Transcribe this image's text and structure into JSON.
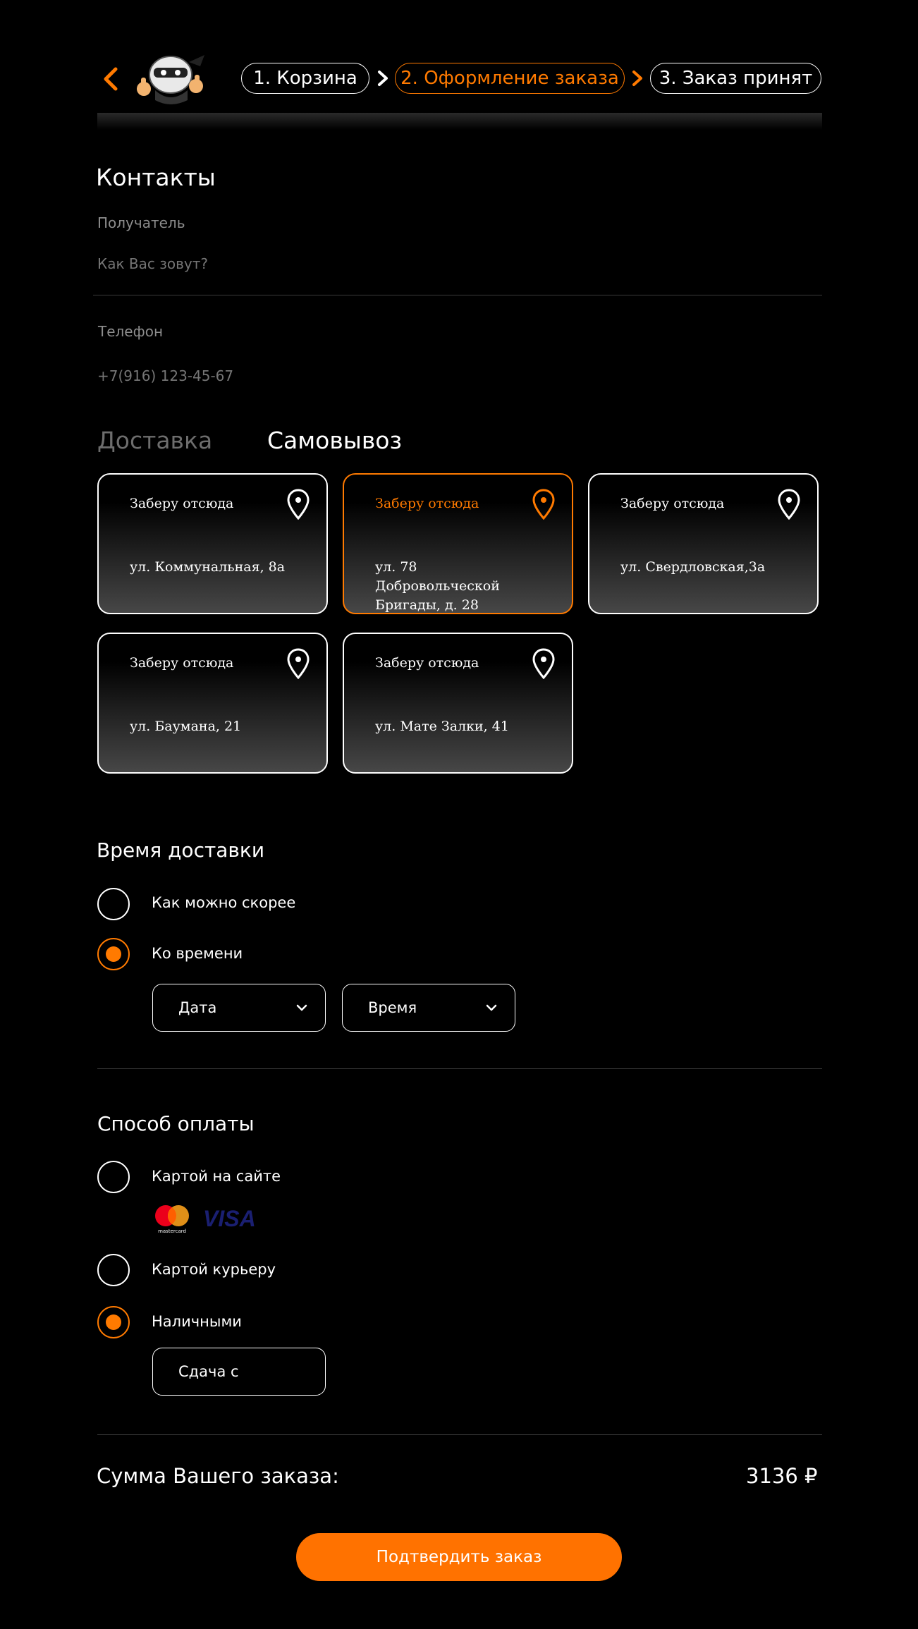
{
  "colors": {
    "accent": "#ff7a00",
    "background": "#000000",
    "muted": "#8c8c8c"
  },
  "header": {
    "steps": [
      {
        "label": "1. Корзина"
      },
      {
        "label": "2. Оформление заказа"
      },
      {
        "label": "3. Заказ принят"
      }
    ]
  },
  "contacts": {
    "title": "Контакты",
    "recipient_label": "Получатель",
    "recipient_placeholder": "Как Вас зовут?",
    "phone_label": "Телефон",
    "phone_placeholder": "+7(916) 123-45-67"
  },
  "delivery_tabs": {
    "delivery": "Доставка",
    "pickup": "Самовывоз"
  },
  "pickup_points": [
    {
      "label": "Заберу отсюда",
      "address": "ул. Коммунальная, 8а"
    },
    {
      "label": "Заберу отсюда",
      "address": "ул. 78 Добровольческой Бригады, д. 28"
    },
    {
      "label": "Заберу отсюда",
      "address": "ул. Свердловская,3а"
    },
    {
      "label": "Заберу отсюда",
      "address": "ул. Баумана, 21"
    },
    {
      "label": "Заберу отсюда",
      "address": "ул. Мате Залки, 41"
    }
  ],
  "delivery_time": {
    "title": "Время доставки",
    "asap": "Как можно скорее",
    "by_time": "Ко времени",
    "date_select": "Дата",
    "time_select": "Время"
  },
  "payment": {
    "title": "Способ оплаты",
    "card_online": "Картой на сайте",
    "card_courier": "Картой курьеру",
    "cash": "Наличными",
    "change_placeholder": "Сдача с",
    "mastercard_text": "mastercard",
    "visa_text": "VISA"
  },
  "summary": {
    "label": "Сумма Вашего заказа:",
    "amount": "3136 ₽"
  },
  "confirm_label": "Подтвердить заказ"
}
